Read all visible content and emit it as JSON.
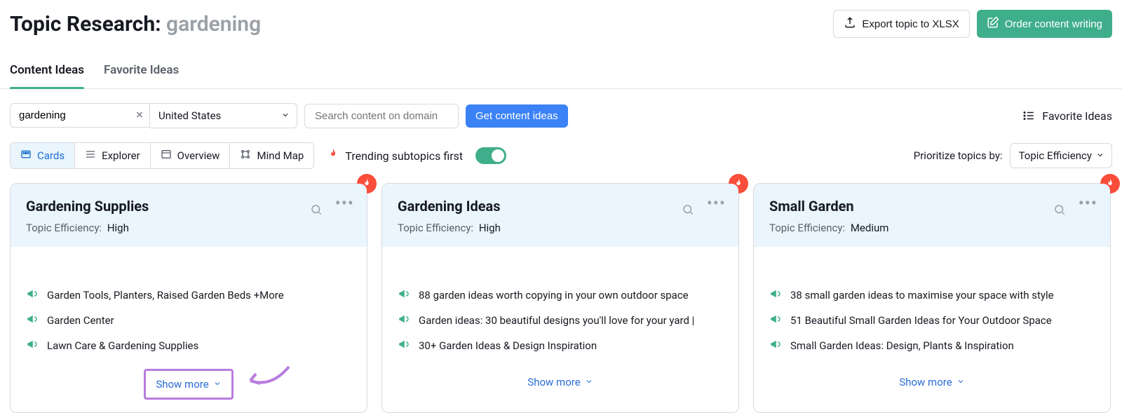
{
  "header": {
    "title_prefix": "Topic Research: ",
    "title_topic": "gardening",
    "export_label": "Export topic to XLSX",
    "order_label": "Order content writing"
  },
  "tabs": {
    "content": "Content Ideas",
    "favorite": "Favorite Ideas"
  },
  "controls": {
    "keyword": "gardening",
    "country": "United States",
    "search_placeholder": "Search content on domain",
    "get_button": "Get content ideas",
    "favorite_link": "Favorite Ideas"
  },
  "views": {
    "cards": "Cards",
    "explorer": "Explorer",
    "overview": "Overview",
    "mindmap": "Mind Map",
    "trending_label": "Trending subtopics first",
    "prioritize_label": "Prioritize topics by:",
    "prioritize_value": "Topic Efficiency"
  },
  "cards": [
    {
      "title": "Gardening Supplies",
      "efficiency_label": "Topic Efficiency:",
      "efficiency_value": "High",
      "ideas": [
        "Garden Tools, Planters, Raised Garden Beds +More",
        "Garden Center",
        "Lawn Care & Gardening Supplies"
      ],
      "show_more": "Show more"
    },
    {
      "title": "Gardening Ideas",
      "efficiency_label": "Topic Efficiency:",
      "efficiency_value": "High",
      "ideas": [
        "88 garden ideas worth copying in your own outdoor space",
        "Garden ideas: 30 beautiful designs you'll love for your yard |",
        "30+ Garden Ideas & Design Inspiration"
      ],
      "show_more": "Show more"
    },
    {
      "title": "Small Garden",
      "efficiency_label": "Topic Efficiency:",
      "efficiency_value": "Medium",
      "ideas": [
        "38 small garden ideas to maximise your space with style",
        "51 Beautiful Small Garden Ideas for Your Outdoor Space",
        "Small Garden Ideas: Design, Plants & Inspiration"
      ],
      "show_more": "Show more"
    }
  ]
}
